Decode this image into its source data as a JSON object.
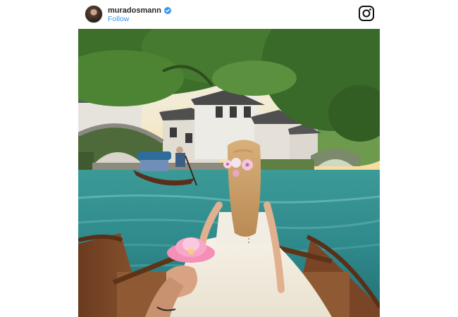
{
  "post": {
    "username": "muradosmann",
    "follow_label": "Follow",
    "verified": true
  },
  "icons": {
    "avatar": "profile-avatar",
    "verified": "verified-badge-icon",
    "instagram": "instagram-logo-icon"
  },
  "colors": {
    "link": "#3897f0",
    "verified": "#3897f0",
    "text": "#262626",
    "background": "#ffffff"
  }
}
